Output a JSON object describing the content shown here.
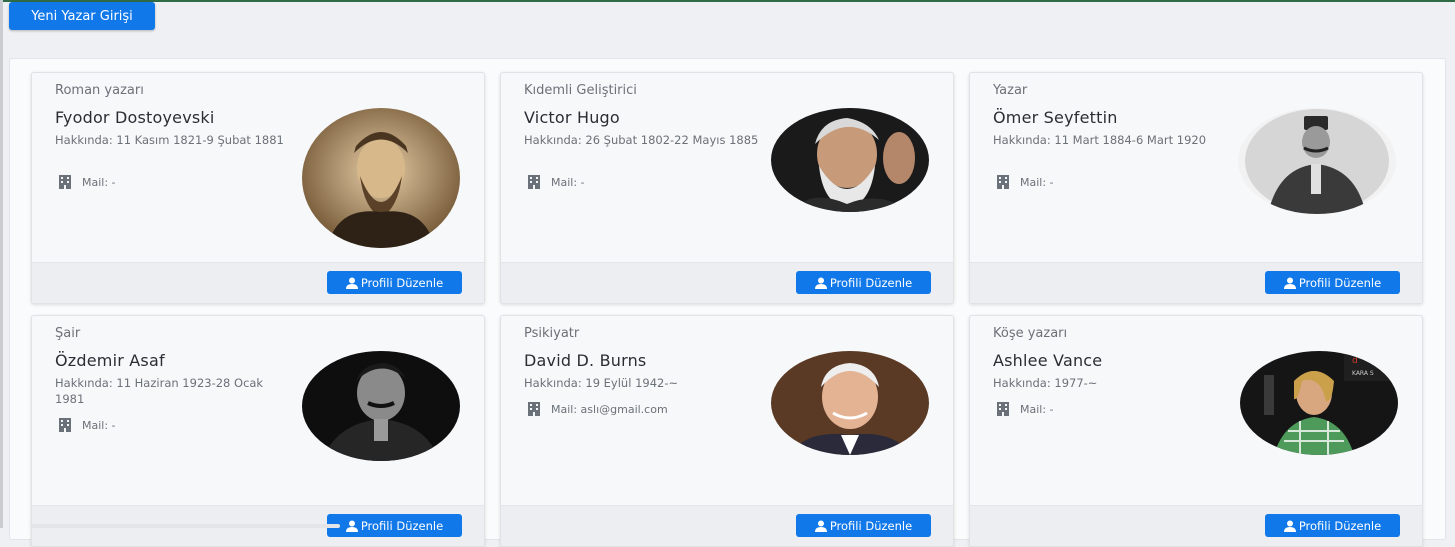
{
  "header": {
    "new_author_label": "Yeni Yazar Girişi"
  },
  "cards": [
    {
      "role": "Roman yazarı",
      "name": "Fyodor Dostoyevski",
      "about": "Hakkında: 11 Kasım 1821-9 Şubat 1881",
      "mail": "Mail: -",
      "edit_label": "Profili Düzenle"
    },
    {
      "role": "Kıdemli Geliştirici",
      "name": "Victor Hugo",
      "about": "Hakkında: 26 Şubat 1802-22 Mayıs 1885",
      "mail": "Mail: -",
      "edit_label": "Profili Düzenle"
    },
    {
      "role": "Yazar",
      "name": "Ömer Seyfettin",
      "about": "Hakkında: 11 Mart 1884-6 Mart 1920",
      "mail": "Mail: -",
      "edit_label": "Profili Düzenle"
    },
    {
      "role": "Şair",
      "name": "Özdemir Asaf",
      "about": "Hakkında: 11 Haziran 1923-28 Ocak 1981",
      "mail": "Mail: -",
      "edit_label": "Profili Düzenle"
    },
    {
      "role": "Psikiyatr",
      "name": "David D. Burns",
      "about": "Hakkında: 19 Eylül 1942-~",
      "mail": "Mail: aslı@gmail.com",
      "edit_label": "Profili Düzenle"
    },
    {
      "role": "Köşe yazarı",
      "name": "Ashlee Vance",
      "about": "Hakkında: 1977-~",
      "mail": "Mail: -",
      "edit_label": "Profili Düzenle"
    }
  ],
  "icons": {
    "mail": "building-icon",
    "edit": "user-icon"
  },
  "colors": {
    "primary": "#1178e9",
    "card_bg": "#f7f8fa",
    "footer_bg": "#eceef1"
  }
}
